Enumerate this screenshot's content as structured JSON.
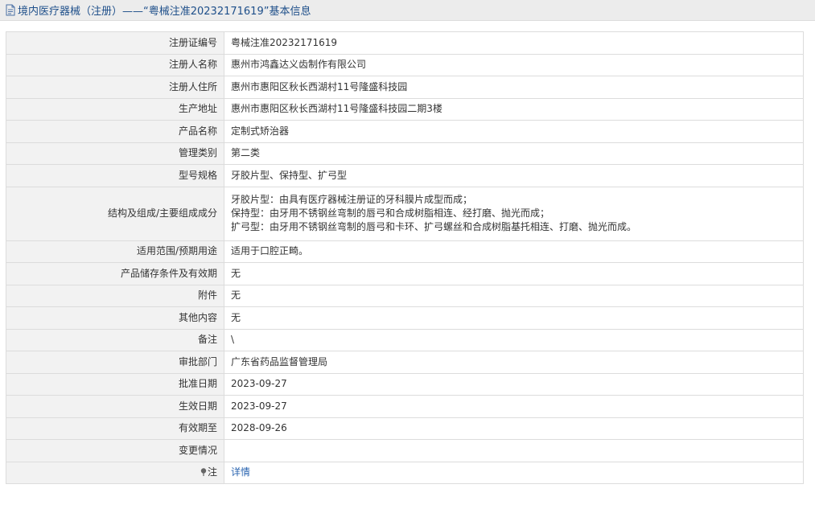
{
  "header": {
    "title": "境内医疗器械（注册）——“粤械注准20232171619”基本信息"
  },
  "rows": [
    {
      "label": "注册证编号",
      "value": "粤械注准20232171619"
    },
    {
      "label": "注册人名称",
      "value": "惠州市鸿鑫达义齿制作有限公司"
    },
    {
      "label": "注册人住所",
      "value": "惠州市惠阳区秋长西湖村11号隆盛科技园"
    },
    {
      "label": "生产地址",
      "value": "惠州市惠阳区秋长西湖村11号隆盛科技园二期3楼"
    },
    {
      "label": "产品名称",
      "value": "定制式矫治器"
    },
    {
      "label": "管理类别",
      "value": "第二类"
    },
    {
      "label": "型号规格",
      "value": "牙胶片型、保持型、扩弓型"
    }
  ],
  "structure": {
    "label": "结构及组成/主要组成成分",
    "lines": [
      "牙胶片型：由具有医疗器械注册证的牙科膜片成型而成；",
      "保持型：由牙用不锈钢丝弯制的唇弓和合成树脂相连、经打磨、抛光而成；",
      "扩弓型：由牙用不锈钢丝弯制的唇弓和卡环、扩弓螺丝和合成树脂基托相连、打磨、抛光而成。"
    ]
  },
  "rows2": [
    {
      "label": "适用范围/预期用途",
      "value": "适用于口腔正畸。"
    },
    {
      "label": "产品储存条件及有效期",
      "value": "无"
    },
    {
      "label": "附件",
      "value": "无"
    },
    {
      "label": "其他内容",
      "value": "无"
    },
    {
      "label": "备注",
      "value": "\\"
    },
    {
      "label": "审批部门",
      "value": "广东省药品监督管理局"
    },
    {
      "label": "批准日期",
      "value": "2023-09-27"
    },
    {
      "label": "生效日期",
      "value": "2023-09-27"
    },
    {
      "label": "有效期至",
      "value": "2028-09-26"
    },
    {
      "label": "变更情况",
      "value": ""
    }
  ],
  "note": {
    "label": "注",
    "link": "详情",
    "icon": "pin-icon"
  },
  "colors": {
    "title": "#1e4f8a",
    "link": "#2a64b0",
    "label_bg": "#f2f2f2"
  }
}
